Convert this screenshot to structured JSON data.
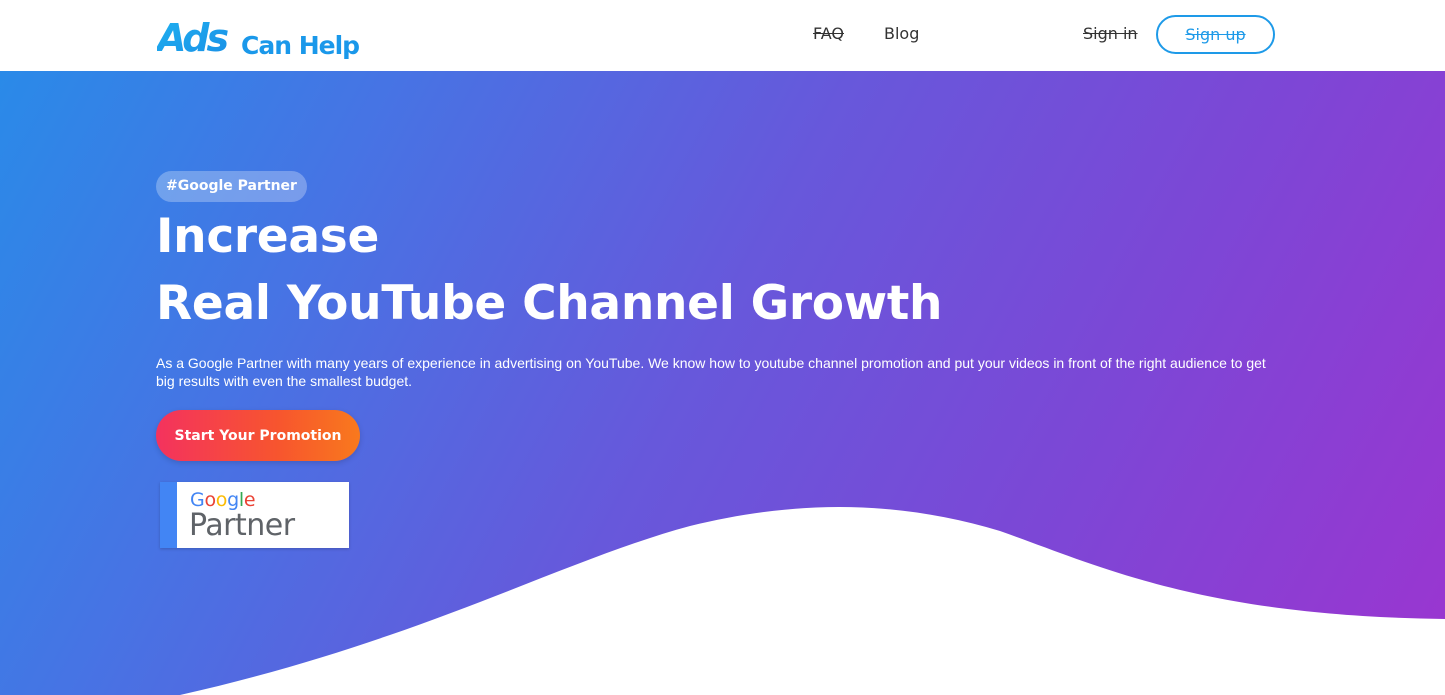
{
  "header": {
    "logo": {
      "part1": "Ads",
      "part2": "Can Help"
    },
    "nav": {
      "faq": "FAQ",
      "blog": "Blog"
    },
    "sign_in": "Sign in",
    "sign_up": "Sign up"
  },
  "hero": {
    "badge": "#Google Partner",
    "headline_line1": "Increase",
    "headline_line2": "Real YouTube Channel Growth",
    "description": "As a Google Partner with many years of experience in advertising on YouTube. We know how to youtube channel promotion and put your videos in front of the right audience to get big results with even the smallest budget.",
    "cta_label": "Start Your Promotion",
    "partner_badge": {
      "google": "Google",
      "partner": "Partner"
    }
  },
  "colors": {
    "accent_blue": "#1e9ae8",
    "gradient_start": "#2a8ae8",
    "gradient_end": "#9b35d0",
    "cta_start": "#f4325e",
    "cta_end": "#f9791d",
    "google_blue": "#4285f4",
    "google_red": "#ea4335",
    "google_yellow": "#fbbc05",
    "google_green": "#34a853"
  }
}
